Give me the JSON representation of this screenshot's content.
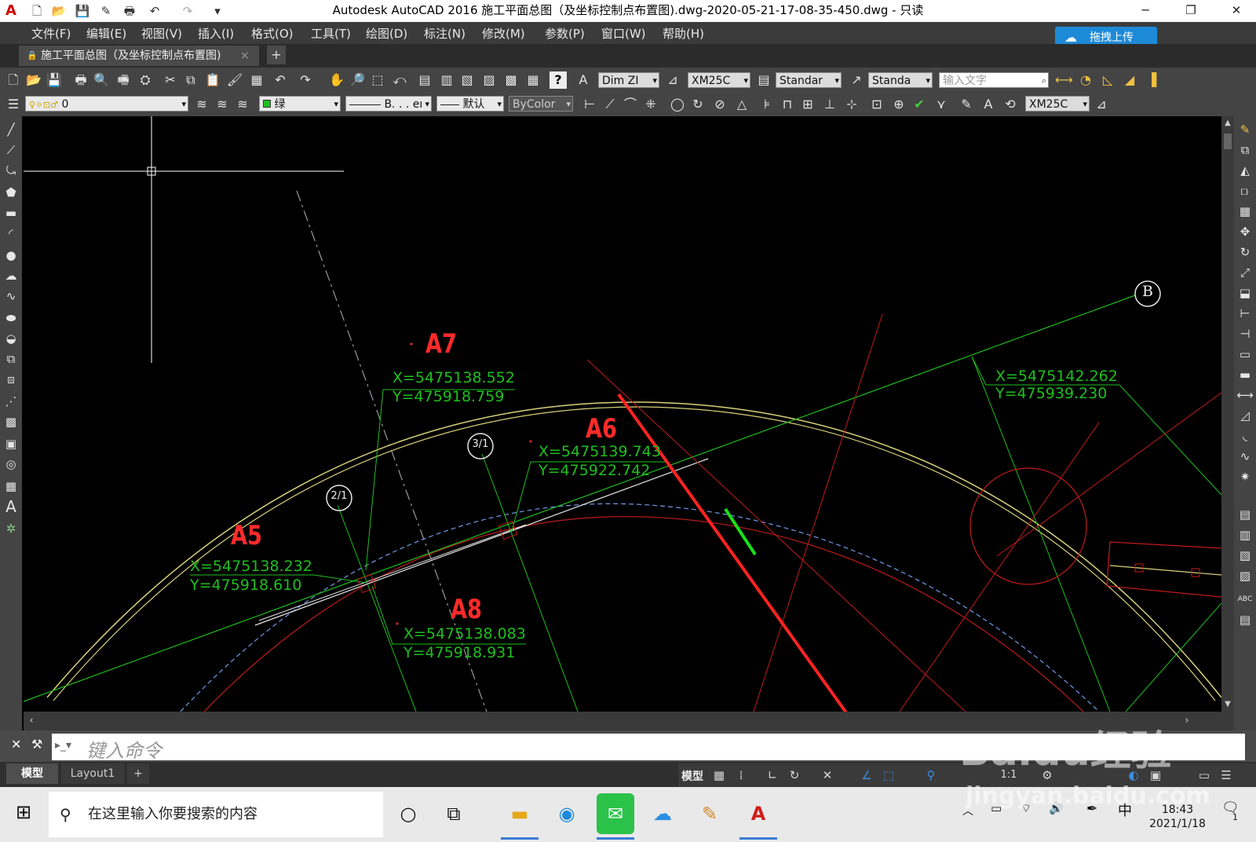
{
  "window": {
    "title": "Autodesk AutoCAD 2016    施工平面总图（及坐标控制点布置图).dwg-2020-05-21-17-08-35-450.dwg - 只读",
    "minimize": "─",
    "restore": "❐",
    "close": "✕"
  },
  "menu": [
    "文件(F)",
    "编辑(E)",
    "视图(V)",
    "插入(I)",
    "格式(O)",
    "工具(T)",
    "绘图(D)",
    "标注(N)",
    "修改(M)",
    "参数(P)",
    "窗口(W)",
    "帮助(H)"
  ],
  "upload_button": "拖拽上传",
  "doc_tab": {
    "label": "施工平面总图（及坐标控制点布置图)",
    "close": "×",
    "new_tab": "+"
  },
  "toolbar1": {
    "dim_style": "Dim ZI",
    "dim_scale": "XM25C",
    "text_style": "Standar",
    "table_style": "Standa",
    "text_input_placeholder": "输入文字"
  },
  "toolbar2": {
    "layer": "0",
    "color": "绿",
    "linetype": "B. . . eı",
    "lineweight": "默认",
    "plotstyle": "ByColor",
    "dim_scale2": "XM25C"
  },
  "drawing": {
    "points": [
      {
        "id": "A7",
        "x": "X=5475138.552",
        "y": "Y=475918.759"
      },
      {
        "id": "A6",
        "x": "X=5475139.743",
        "y": "Y=475922.742"
      },
      {
        "id": "A5",
        "x": "X=5475138.232",
        "y": "Y=475918.610"
      },
      {
        "id": "A8",
        "x": "X=5475138.083",
        "y": "Y=475918.931"
      }
    ],
    "unlabeled_coords": {
      "x": "X=5475142.262",
      "y": "Y=475939.230"
    },
    "axis_bubbles": [
      "B",
      "3/1",
      "2/1"
    ],
    "colors": {
      "label_red": "#ff2a2a",
      "coord_green": "#1fbf1f",
      "arc_yellow": "#d8d27a",
      "arc_red": "#b01a1a",
      "dash_blue": "#6c8fd8",
      "callout_arrow": "#ff2222"
    }
  },
  "command": {
    "placeholder": "键入命令",
    "close_icon": "✕",
    "wrench_icon": "🔧"
  },
  "layouts": {
    "tabs": [
      "模型",
      "Layout1"
    ],
    "add": "+"
  },
  "status": {
    "model": "模型",
    "scale": "1:1"
  },
  "taskbar": {
    "search_placeholder": "在这里输入你要搜索的内容",
    "ime": "中",
    "time": "18:43",
    "date": "2021/1/18",
    "notification_count": "1"
  },
  "watermark": {
    "brand": "Baidu经验",
    "url": "jingyan.baidu.com"
  }
}
